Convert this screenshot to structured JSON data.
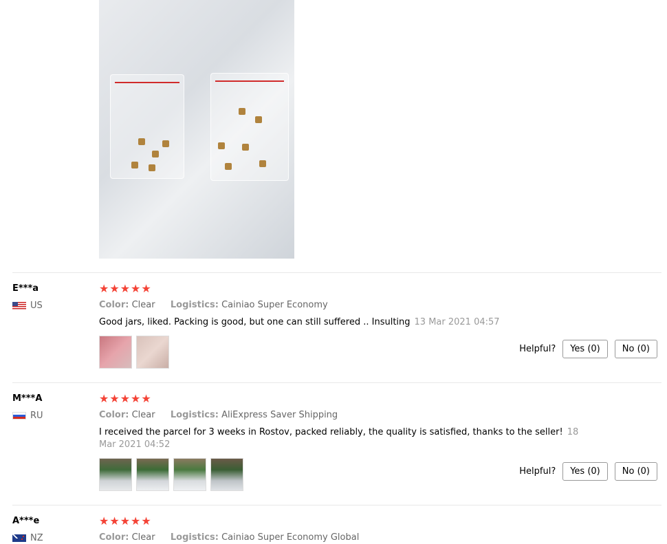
{
  "reviews": [
    {
      "user": "E***a",
      "country": "US",
      "stars": "★★★★★",
      "color_label": "Color:",
      "color_value": "Clear",
      "logistics_label": "Logistics:",
      "logistics_value": "Cainiao Super Economy",
      "text": "Good jars, liked. Packing is good, but one can still suffered .. Insulting",
      "date": "13 Mar 2021 04:57",
      "helpful_label": "Helpful?",
      "yes_label": "Yes (0)",
      "no_label": "No (0)"
    },
    {
      "user": "M***A",
      "country": "RU",
      "stars": "★★★★★",
      "color_label": "Color:",
      "color_value": "Clear",
      "logistics_label": "Logistics:",
      "logistics_value": "AliExpress Saver Shipping",
      "text": "I received the parcel for 3 weeks in Rostov, packed reliably, the quality is satisfied, thanks to the seller!",
      "date": "18 Mar 2021 04:52",
      "helpful_label": "Helpful?",
      "yes_label": "Yes (0)",
      "no_label": "No (0)"
    },
    {
      "user": "A***e",
      "country": "NZ",
      "stars": "★★★★★",
      "color_label": "Color:",
      "color_value": "Clear",
      "logistics_label": "Logistics:",
      "logistics_value": "Cainiao Super Economy Global"
    }
  ]
}
